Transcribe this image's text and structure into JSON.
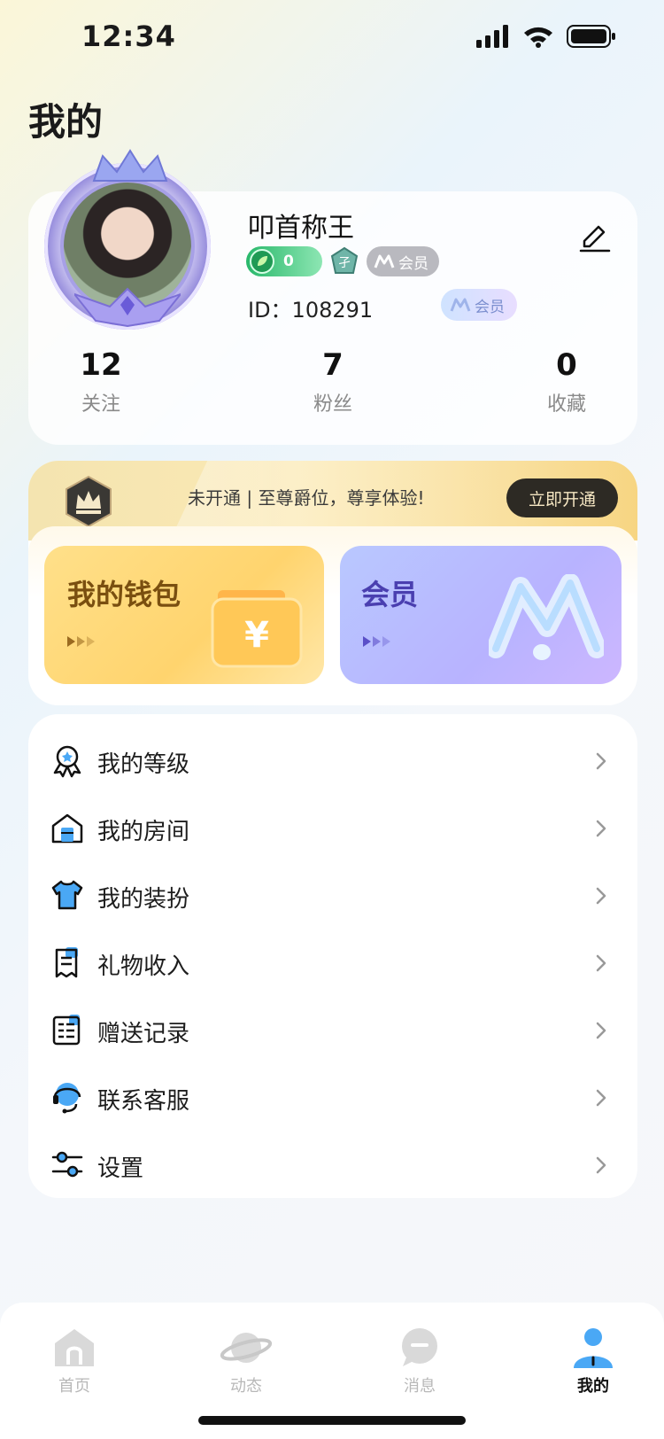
{
  "status_bar": {
    "time": "12:34"
  },
  "page": {
    "title": "我的"
  },
  "profile": {
    "username": "叩首称王",
    "level_badge_value": "0",
    "vip_pill_label": "会员",
    "id_text": "ID：108291",
    "vip_pill_blue_label": "会员",
    "stats": [
      {
        "value": "12",
        "label": "关注"
      },
      {
        "value": "7",
        "label": "粉丝"
      },
      {
        "value": "0",
        "label": "收藏"
      }
    ]
  },
  "vip_strip": {
    "text": "未开通 | 至尊爵位，尊享体验!",
    "button_label": "立即开通"
  },
  "cards": {
    "wallet_title": "我的钱包",
    "member_title": "会员"
  },
  "menu": {
    "items": [
      {
        "label": "我的等级",
        "icon": "rank-badge-icon"
      },
      {
        "label": "我的房间",
        "icon": "room-icon"
      },
      {
        "label": "我的装扮",
        "icon": "shirt-icon"
      },
      {
        "label": "礼物收入",
        "icon": "receipt-icon"
      },
      {
        "label": "赠送记录",
        "icon": "record-list-icon"
      },
      {
        "label": "联系客服",
        "icon": "headset-icon"
      },
      {
        "label": "设置",
        "icon": "settings-sliders-icon"
      }
    ]
  },
  "bottom_nav": {
    "items": [
      {
        "label": "首页",
        "icon": "home-icon"
      },
      {
        "label": "动态",
        "icon": "planet-icon"
      },
      {
        "label": "消息",
        "icon": "message-bubble-icon"
      },
      {
        "label": "我的",
        "icon": "person-icon",
        "active": true
      }
    ]
  },
  "colors": {
    "accent_blue": "#4aa8f5",
    "gold": "#f6d27a",
    "purple": "#b8b3ff"
  }
}
